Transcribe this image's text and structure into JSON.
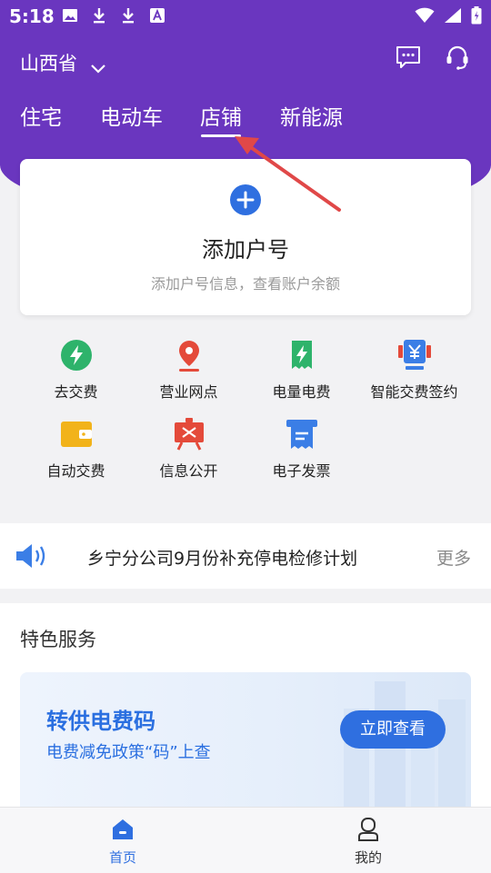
{
  "status_bar": {
    "time": "5:18"
  },
  "header": {
    "region": "山西省",
    "tabs": [
      {
        "label": "住宅"
      },
      {
        "label": "电动车"
      },
      {
        "label": "店铺"
      },
      {
        "label": "新能源"
      }
    ],
    "active_tab_index": 2
  },
  "add_account": {
    "title": "添加户号",
    "subtitle": "添加户号信息，查看账户余额"
  },
  "services": [
    {
      "label": "去交费",
      "icon": "lightning-icon"
    },
    {
      "label": "营业网点",
      "icon": "location-pin-icon"
    },
    {
      "label": "电量电费",
      "icon": "bolt-bill-icon"
    },
    {
      "label": "智能交费签约",
      "icon": "yen-contract-icon"
    },
    {
      "label": "自动交费",
      "icon": "wallet-icon"
    },
    {
      "label": "信息公开",
      "icon": "board-icon"
    },
    {
      "label": "电子发票",
      "icon": "invoice-icon"
    }
  ],
  "notice": {
    "text": "乡宁分公司9月份补充停电检修计划",
    "more": "更多"
  },
  "feature_section": {
    "title": "特色服务",
    "card": {
      "title": "转供电费码",
      "subtitle": "电费减免政策“码”上查",
      "button": "立即查看"
    }
  },
  "bottom_nav": [
    {
      "label": "首页",
      "active": true
    },
    {
      "label": "我的",
      "active": false
    }
  ],
  "colors": {
    "brand_purple": "#6a36bf",
    "accent_blue": "#2f6fe0",
    "annotation_arrow": "#e04848"
  }
}
